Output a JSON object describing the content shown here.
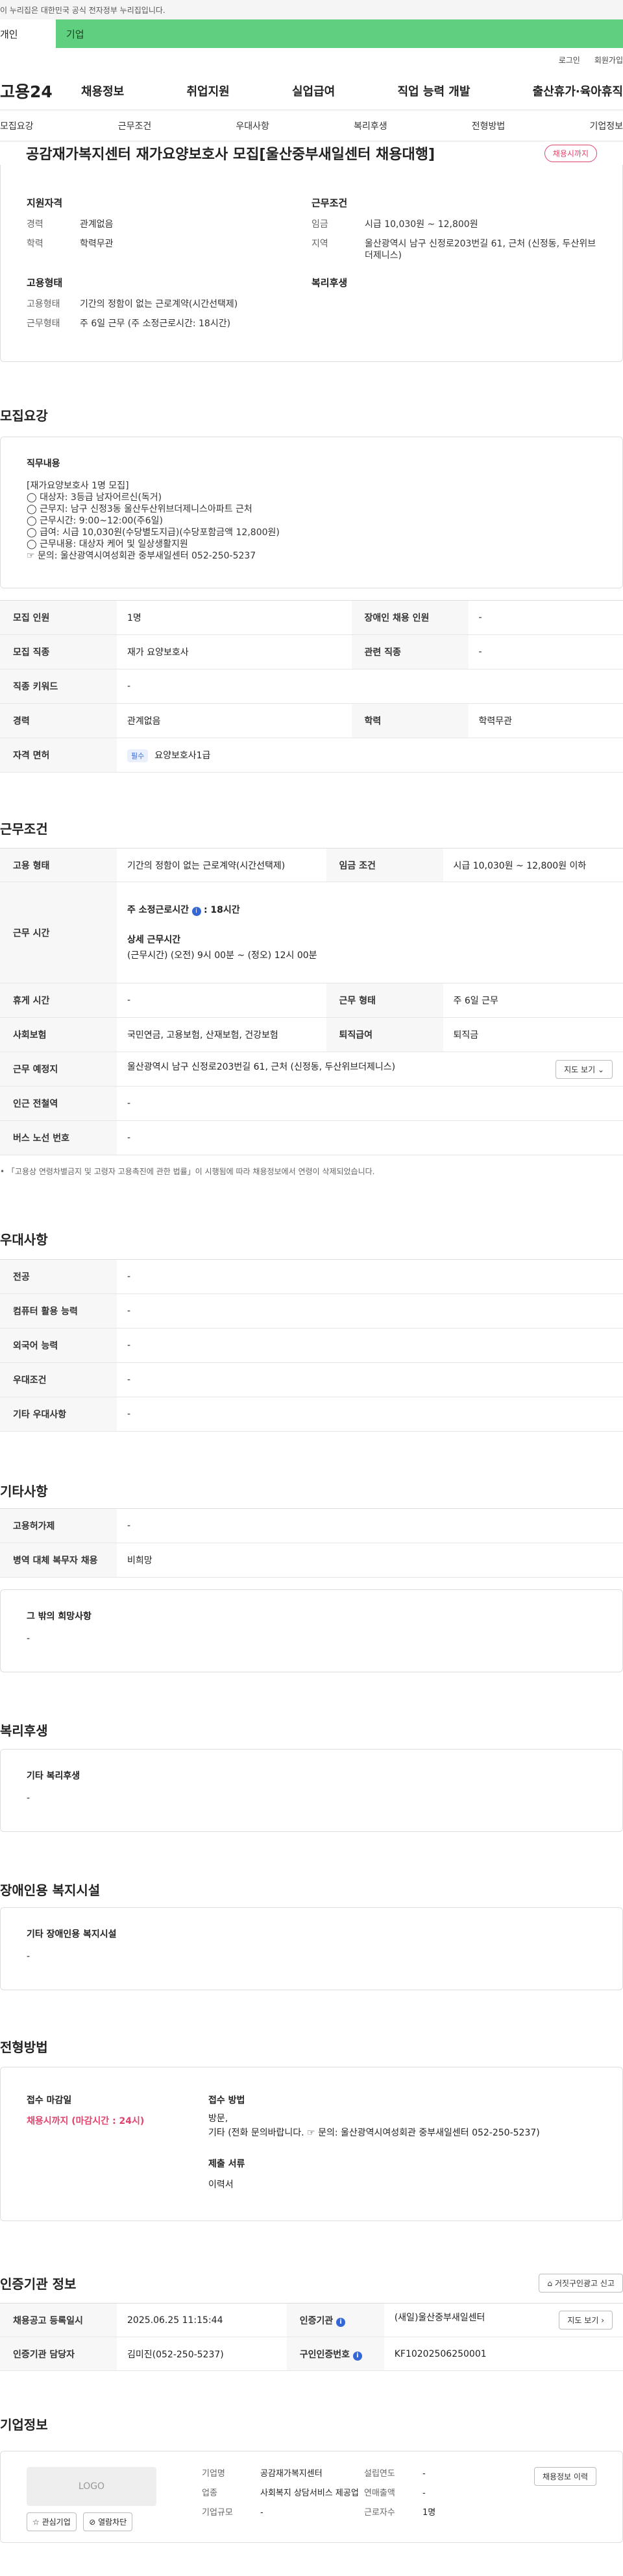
{
  "gov_banner": "이 누리집은 대한민국 공식 전자정부 누리집입니다.",
  "top_tabs": [
    "개인",
    "기업"
  ],
  "util_links": [
    "로그인",
    "회원가입"
  ],
  "logo": "고용24",
  "main_menu": [
    "채용정보",
    "취업지원",
    "실업급여",
    "직업 능력 개발",
    "출산휴가·육아휴직"
  ],
  "sub_nav": [
    "모집요강",
    "근무조건",
    "우대사항",
    "복리후생",
    "전형방법",
    "기업정보"
  ],
  "title": "공감재가복지센터 재가요양보호사 모집[울산중부새일센터 채용대행]",
  "status_badge": "채용시까지",
  "summary": {
    "qual_title": "지원자격",
    "qual": [
      {
        "k": "경력",
        "v": "관계없음"
      },
      {
        "k": "학력",
        "v": "학력무관"
      }
    ],
    "work_title": "근무조건",
    "work": [
      {
        "k": "임금",
        "v": "시급 10,030원 ~ 12,800원"
      },
      {
        "k": "지역",
        "v": "울산광역시 남구 신정로203번길 61, 근처 (신정동, 두산위브더제니스)"
      }
    ],
    "emp_title": "고용형태",
    "emp": [
      {
        "k": "고용형태",
        "v": "기간의 정함이 없는 근로계약(시간선택제)"
      },
      {
        "k": "근무형태",
        "v": "주 6일 근무 (주 소정근로시간: 18시간)"
      }
    ],
    "welfare_title": "복리후생"
  },
  "recruit": {
    "title": "모집요강",
    "desc_title": "직무내용",
    "desc_lines": [
      "[재가요양보호사 1명 모집]",
      "◯ 대상자: 3등급 남자어르신(독거)",
      "◯ 근무지: 남구 신정3동 울산두산위브더제니스아파트 근처",
      "◯ 근무시간: 9:00~12:00(주6일)",
      "◯ 급여: 시급 10,030원(수당별도지급)(수당포함금액 12,800원)",
      "◯ 근무내용: 대상자 케어 및 일상생활지원",
      "☞ 문의: 울산광역시여성회관 중부새일센터 052-250-5237"
    ],
    "rows": [
      {
        "k1": "모집 인원",
        "v1": "1명",
        "k2": "장애인 채용 인원",
        "v2": "-"
      },
      {
        "k1": "모집 직종",
        "v1": "재가 요양보호사",
        "k2": "관련 직종",
        "v2": "-"
      },
      {
        "k1": "직종 키워드",
        "v1": "-"
      },
      {
        "k1": "경력",
        "v1": "관계없음",
        "k2": "학력",
        "v2": "학력무관"
      }
    ],
    "license_label": "자격 면허",
    "license_chip": "필수",
    "license_value": "요양보호사1급"
  },
  "conditions": {
    "title": "근무조건",
    "emp_type_label": "고용 형태",
    "emp_type": "기간의 정함이 없는 근로계약(시간선택제)",
    "wage_label": "임금 조건",
    "wage": "시급 10,030원 ~ 12,800원 이하",
    "hours_label": "근무 시간",
    "weekly_hours_label": "주 소정근로시간",
    "weekly_hours": ": 18시간",
    "detail_label": "상세 근무시간",
    "detail": "(근무시간) (오전) 9시 00분 ~ (정오) 12시 00분",
    "break_label": "휴게 시간",
    "break": "-",
    "work_form_label": "근무 형태",
    "work_form": "주 6일 근무",
    "insurance_label": "사회보험",
    "insurance": "국민연금, 고용보험, 산재보험, 건강보험",
    "retire_label": "퇴직급여",
    "retire": "퇴직금",
    "place_label": "근무 예정지",
    "place": "울산광역시 남구 신정로203번길 61, 근처 (신정동, 두산위브더제니스)",
    "map_btn": "지도 보기",
    "subway_label": "인근 전철역",
    "subway": "-",
    "bus_label": "버스 노선 번호",
    "bus": "-",
    "note": "「고용상 연령차별금지 및 고령자 고용촉진에 관한 법률」이 시행됨에 따라 채용정보에서 연령이 삭제되었습니다."
  },
  "preference": {
    "title": "우대사항",
    "rows": [
      {
        "k": "전공",
        "v": "-"
      },
      {
        "k": "컴퓨터 활용 능력",
        "v": "-"
      },
      {
        "k": "외국어 능력",
        "v": "-"
      },
      {
        "k": "우대조건",
        "v": "-"
      },
      {
        "k": "기타 우대사항",
        "v": "-"
      }
    ]
  },
  "etc": {
    "title": "기타사항",
    "rows": [
      {
        "k": "고용허가제",
        "v": "-"
      },
      {
        "k": "병역 대체 복무자 채용",
        "v": "비희망"
      }
    ],
    "box_title": "그 밖의 희망사항",
    "box_value": "-"
  },
  "welfare": {
    "title": "복리후생",
    "box_title": "기타 복리후생",
    "box_value": "-"
  },
  "disability": {
    "title": "장애인용 복지시설",
    "box_title": "기타 장애인용 복지시설",
    "box_value": "-"
  },
  "process": {
    "title": "전형방법",
    "deadline_label": "접수 마감일",
    "deadline": "채용시까지 (마감시간 : 24시)",
    "method_label": "접수 방법",
    "method_1": "방문,",
    "method_2": "기타 (전화 문의바랍니다. ☞ 문의: 울산광역시여성회관 중부새일센터 052-250-5237)",
    "docs_label": "제출 서류",
    "docs": "이력서"
  },
  "agency": {
    "title": "인증기관 정보",
    "report_btn": "거짓구인광고 신고",
    "reg_label": "채용공고 등록일시",
    "reg": "2025.06.25 11:15:44",
    "org_label": "인증기관",
    "org": "(새일)울산중부새일센터",
    "detail_btn": "지도 보기",
    "manager_label": "인증기관 담당자",
    "manager": "김미진(052-250-5237)",
    "auth_label": "구인인증번호",
    "auth": "KF10202506250001"
  },
  "company": {
    "title": "기업정보",
    "logo": "LOGO",
    "fav_btn": "관심기업",
    "block_btn": "열람차단",
    "name_label": "기업명",
    "name": "공감재가복지센터",
    "industry_label": "업종",
    "industry": "사회복지 상담서비스 제공업",
    "size_label": "기업규모",
    "size": "-",
    "founded_label": "설립연도",
    "founded": "-",
    "revenue_label": "연매출액",
    "revenue": "-",
    "employees_label": "근로자수",
    "employees": "1명",
    "history_btn": "채용정보 이력"
  }
}
